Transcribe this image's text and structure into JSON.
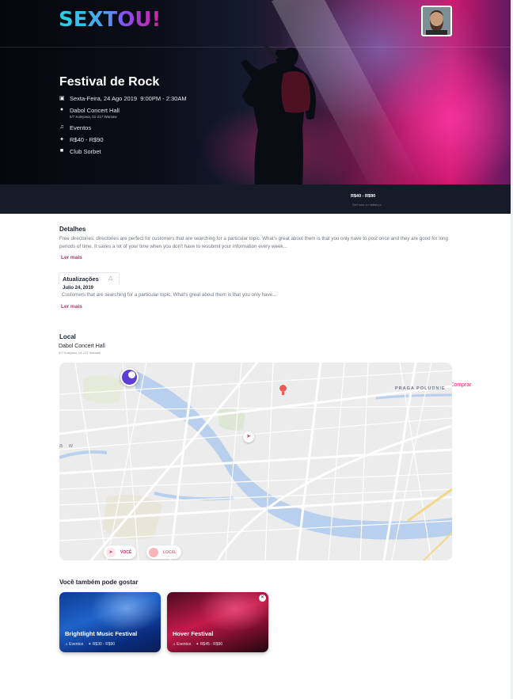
{
  "brand": {
    "logo_text": "SEXTOU!"
  },
  "event": {
    "title": "Festival de Rock",
    "date": "Sexta-Feira, 24 Ago 2019",
    "time": "9:00PM - 2:30AM",
    "venue": "Dabol Concert Hall",
    "venue_address": "5/7 Kolejowa, 01-217 Warsaw",
    "category": "Eventos",
    "price_range": "R$40 - R$90",
    "organizer": "Club Sorbet"
  },
  "buy_bar": {
    "price": "R$40 - R$90",
    "note": "Sell now on sktket.pl",
    "buy_label": "Comprar"
  },
  "details": {
    "heading": "Detalhes",
    "text": "Free directories: directories are perfect for customers that are searching for a particular topic. What's great about them is that you only have to post once and they are good for long periods of time. It saves a lot of your time when you don't have to resubmit your information every week...",
    "more_label": "Ler mais"
  },
  "updates": {
    "tab_label": "Atualizações",
    "date": "Julio 24, 2019",
    "text": "Customers that are searching for a particular topic. What's great about them is that you only have...",
    "more_label": "Ler mais"
  },
  "location": {
    "heading": "Local",
    "venue": "Dabol Concert Hall",
    "address": "5/7 Kolejowa, 01-217 Warsaw",
    "map_labels": {
      "district": "PRAGA POLUDNIE",
      "edge": "a w"
    },
    "legend": {
      "you": "VOCÊ",
      "place": "LOCAL"
    }
  },
  "recommendations": {
    "heading": "Você também pode gostar",
    "items": [
      {
        "title": "Brightlight Music Festival",
        "category": "Eventos",
        "price": "R$30 - R$90"
      },
      {
        "title": "Hover Festival",
        "category": "Eventos",
        "price": "R$45 - R$90"
      }
    ]
  },
  "colors": {
    "accent": "#d6246e",
    "dark_bar": "#151b27",
    "map_water": "#b9cfee",
    "map_base": "#ededed"
  },
  "icons": [
    "calendar-icon",
    "location-pin-icon",
    "music-note-icon",
    "ticket-icon",
    "lock-icon",
    "bell-icon",
    "navigation-arrow-icon",
    "close-icon"
  ]
}
